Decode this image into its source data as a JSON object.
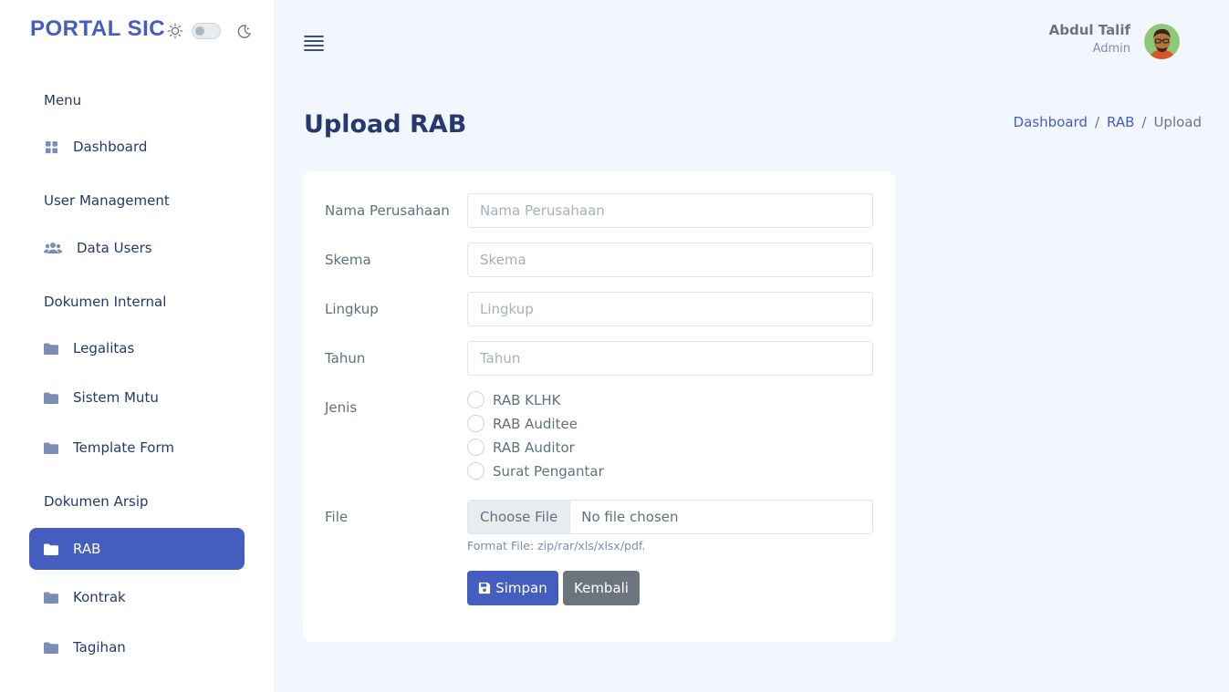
{
  "sidebar": {
    "brand": "PORTAL SIC",
    "sections": {
      "menu": "Menu",
      "user_management": "User Management",
      "dokumen_internal": "Dokumen Internal",
      "dokumen_arsip": "Dokumen Arsip"
    },
    "items": {
      "dashboard": "Dashboard",
      "data_users": "Data Users",
      "legalitas": "Legalitas",
      "sistem_mutu": "Sistem Mutu",
      "template_form": "Template Form",
      "rab": "RAB",
      "kontrak": "Kontrak",
      "tagihan": "Tagihan"
    },
    "active_item": "RAB"
  },
  "header": {
    "user_name": "Abdul Talif",
    "user_role": "Admin"
  },
  "page": {
    "title": "Upload RAB",
    "breadcrumb": [
      "Dashboard",
      "RAB",
      "Upload"
    ]
  },
  "form": {
    "nama_perusahaan": {
      "label": "Nama Perusahaan",
      "placeholder": "Nama Perusahaan",
      "value": ""
    },
    "skema": {
      "label": "Skema",
      "placeholder": "Skema",
      "value": ""
    },
    "lingkup": {
      "label": "Lingkup",
      "placeholder": "Lingkup",
      "value": ""
    },
    "tahun": {
      "label": "Tahun",
      "placeholder": "Tahun",
      "value": ""
    },
    "jenis": {
      "label": "Jenis",
      "options": [
        "RAB KLHK",
        "RAB Auditee",
        "RAB Auditor",
        "Surat Pengantar"
      ]
    },
    "file": {
      "label": "File",
      "button": "Choose File",
      "status": "No file chosen",
      "help": "Format File: zip/rar/xls/xlsx/pdf."
    },
    "save_label": "Simpan",
    "back_label": "Kembali"
  },
  "colors": {
    "primary": "#435ebe",
    "secondary": "#6c757d",
    "background": "#f2f7ff",
    "text": "#25396f"
  },
  "icons": {
    "theme_light": "sun-icon",
    "theme_dark": "moon-icon",
    "menu_toggle": "hamburger-icon",
    "dashboard": "grid-icon",
    "users": "users-icon",
    "folder": "folder-icon",
    "save": "floppy-disk-icon"
  }
}
